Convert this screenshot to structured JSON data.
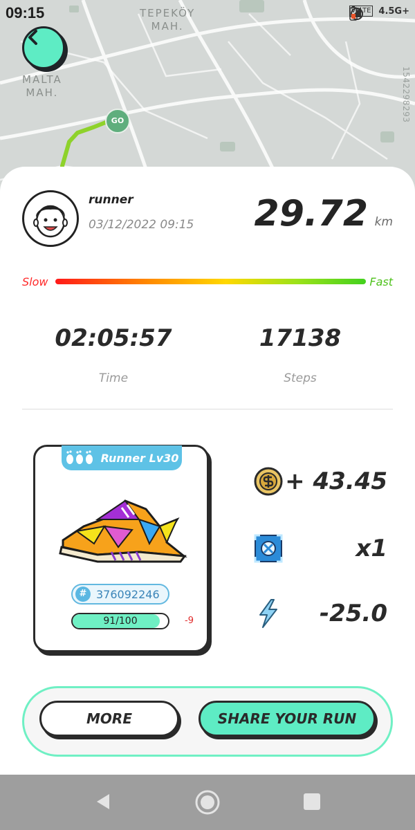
{
  "status_bar": {
    "time": "09:15",
    "network": "4.5G+"
  },
  "map": {
    "labels": [
      "TEPEKÖY",
      "MAH.",
      "MALTA",
      "MAH."
    ],
    "side_number": "1542298293",
    "go_label": "GO"
  },
  "run": {
    "username": "runner",
    "datetime": "03/12/2022 09:15",
    "distance": "29.72",
    "distance_unit": "km",
    "speed_slow_label": "Slow",
    "speed_fast_label": "Fast",
    "time_value": "02:05:57",
    "time_label": "Time",
    "steps_value": "17138",
    "steps_label": "Steps"
  },
  "sneaker": {
    "tag_label": "Runner Lv30",
    "id": "376092246",
    "durability_text": "91/100",
    "durability_fraction": 0.91,
    "durability_delta": "-9"
  },
  "rewards": [
    {
      "icon": "coin-icon",
      "value": "+ 43.45"
    },
    {
      "icon": "mystery-box-icon",
      "value": "x1"
    },
    {
      "icon": "energy-bolt-icon",
      "value": "-25.0"
    }
  ],
  "buttons": {
    "more": "MORE",
    "share": "SHARE YOUR RUN"
  },
  "colors": {
    "accent": "#5eecc4",
    "tag": "#5ec2e6",
    "slow": "#ff2a2a",
    "fast": "#4fc21d"
  }
}
